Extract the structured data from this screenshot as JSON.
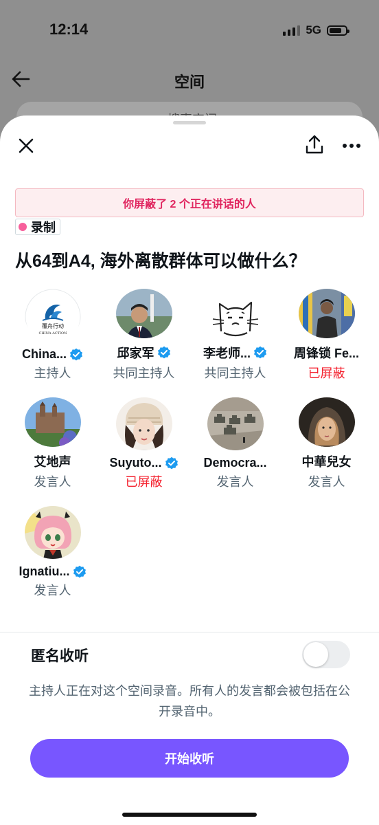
{
  "status_bar": {
    "time": "12:14",
    "network": "5G"
  },
  "background": {
    "title": "空间",
    "search_placeholder": "搜索空间"
  },
  "sheet": {
    "blocked_banner": "你屏蔽了 2 个正在讲话的人",
    "recording_badge": "录制",
    "space_title": "从64到A4, 海外离散群体可以做什么？",
    "participants": [
      {
        "name": "China...",
        "verified": true,
        "role": "主持人",
        "blocked": false,
        "avatar": "logo-avatar",
        "logo_lines": [
          "覆舟行动",
          "CHINA ACTION"
        ]
      },
      {
        "name": "邱家军",
        "verified": true,
        "role": "共同主持人",
        "blocked": false,
        "avatar": "photo-avatar"
      },
      {
        "name": "李老师...",
        "verified": true,
        "role": "共同主持人",
        "blocked": false,
        "avatar": "cat-drawing-avatar"
      },
      {
        "name": "周锋锁 Fe...",
        "verified": false,
        "role": "已屏蔽",
        "blocked": true,
        "avatar": "photo-avatar"
      },
      {
        "name": "艾地声",
        "verified": false,
        "role": "发言人",
        "blocked": false,
        "avatar": "castle-photo-avatar"
      },
      {
        "name": "Suyuto...",
        "verified": true,
        "role": "已屏蔽",
        "blocked": true,
        "avatar": "photo-avatar"
      },
      {
        "name": "Democra...",
        "verified": false,
        "role": "发言人",
        "blocked": false,
        "avatar": "tank-photo-avatar"
      },
      {
        "name": "中華兒女",
        "verified": false,
        "role": "发言人",
        "blocked": false,
        "avatar": "portrait-avatar"
      },
      {
        "name": "Ignatiu...",
        "verified": true,
        "role": "发言人",
        "blocked": false,
        "avatar": "anime-avatar"
      }
    ],
    "anonymous": {
      "label": "匿名收听",
      "enabled": false
    },
    "notice": "主持人正在对这个空间录音。所有人的发言都会被包括在公开录音中。",
    "start_button": "开始收听"
  },
  "colors": {
    "accent": "#7856ff",
    "blocked": "#f4212e",
    "verified": "#1d9bf0",
    "recording": "#f75f9b"
  },
  "icons": [
    "back-arrow-icon",
    "search-icon",
    "close-icon",
    "share-icon",
    "more-icon",
    "verified-badge-icon"
  ]
}
